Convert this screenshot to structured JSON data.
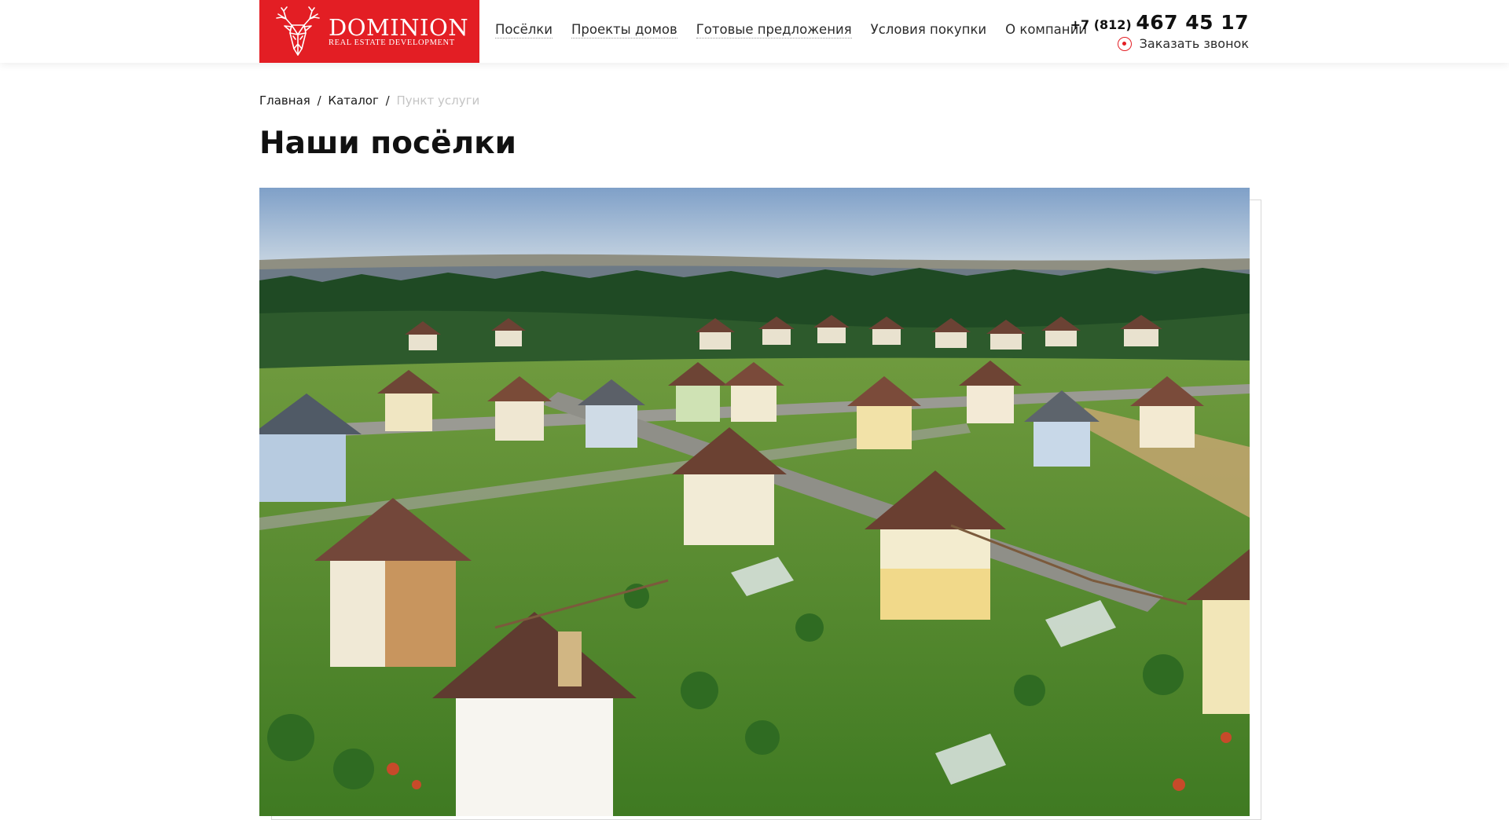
{
  "header": {
    "logo": {
      "name": "DOMINION",
      "subtitle": "REAL ESTATE DEVELOPMENT",
      "color": "#e31e24",
      "icon": "deer-head-icon"
    },
    "nav": [
      {
        "label": "Посёлки"
      },
      {
        "label": "Проекты домов"
      },
      {
        "label": "Готовые предложения"
      },
      {
        "label": "Условия покупки"
      },
      {
        "label": "О компании"
      }
    ],
    "phone": {
      "code": "+7 (812)",
      "number": "467 45 17"
    },
    "callback": {
      "label": "Заказать звонок",
      "icon": "phone-ring-icon"
    }
  },
  "breadcrumb": {
    "items": [
      {
        "label": "Главная"
      },
      {
        "label": "Каталог"
      }
    ],
    "current": "Пункт услуги",
    "separator": "/"
  },
  "page": {
    "title": "Наши посёлки"
  },
  "hero": {
    "image": "aerial-cottage-village-photo"
  }
}
